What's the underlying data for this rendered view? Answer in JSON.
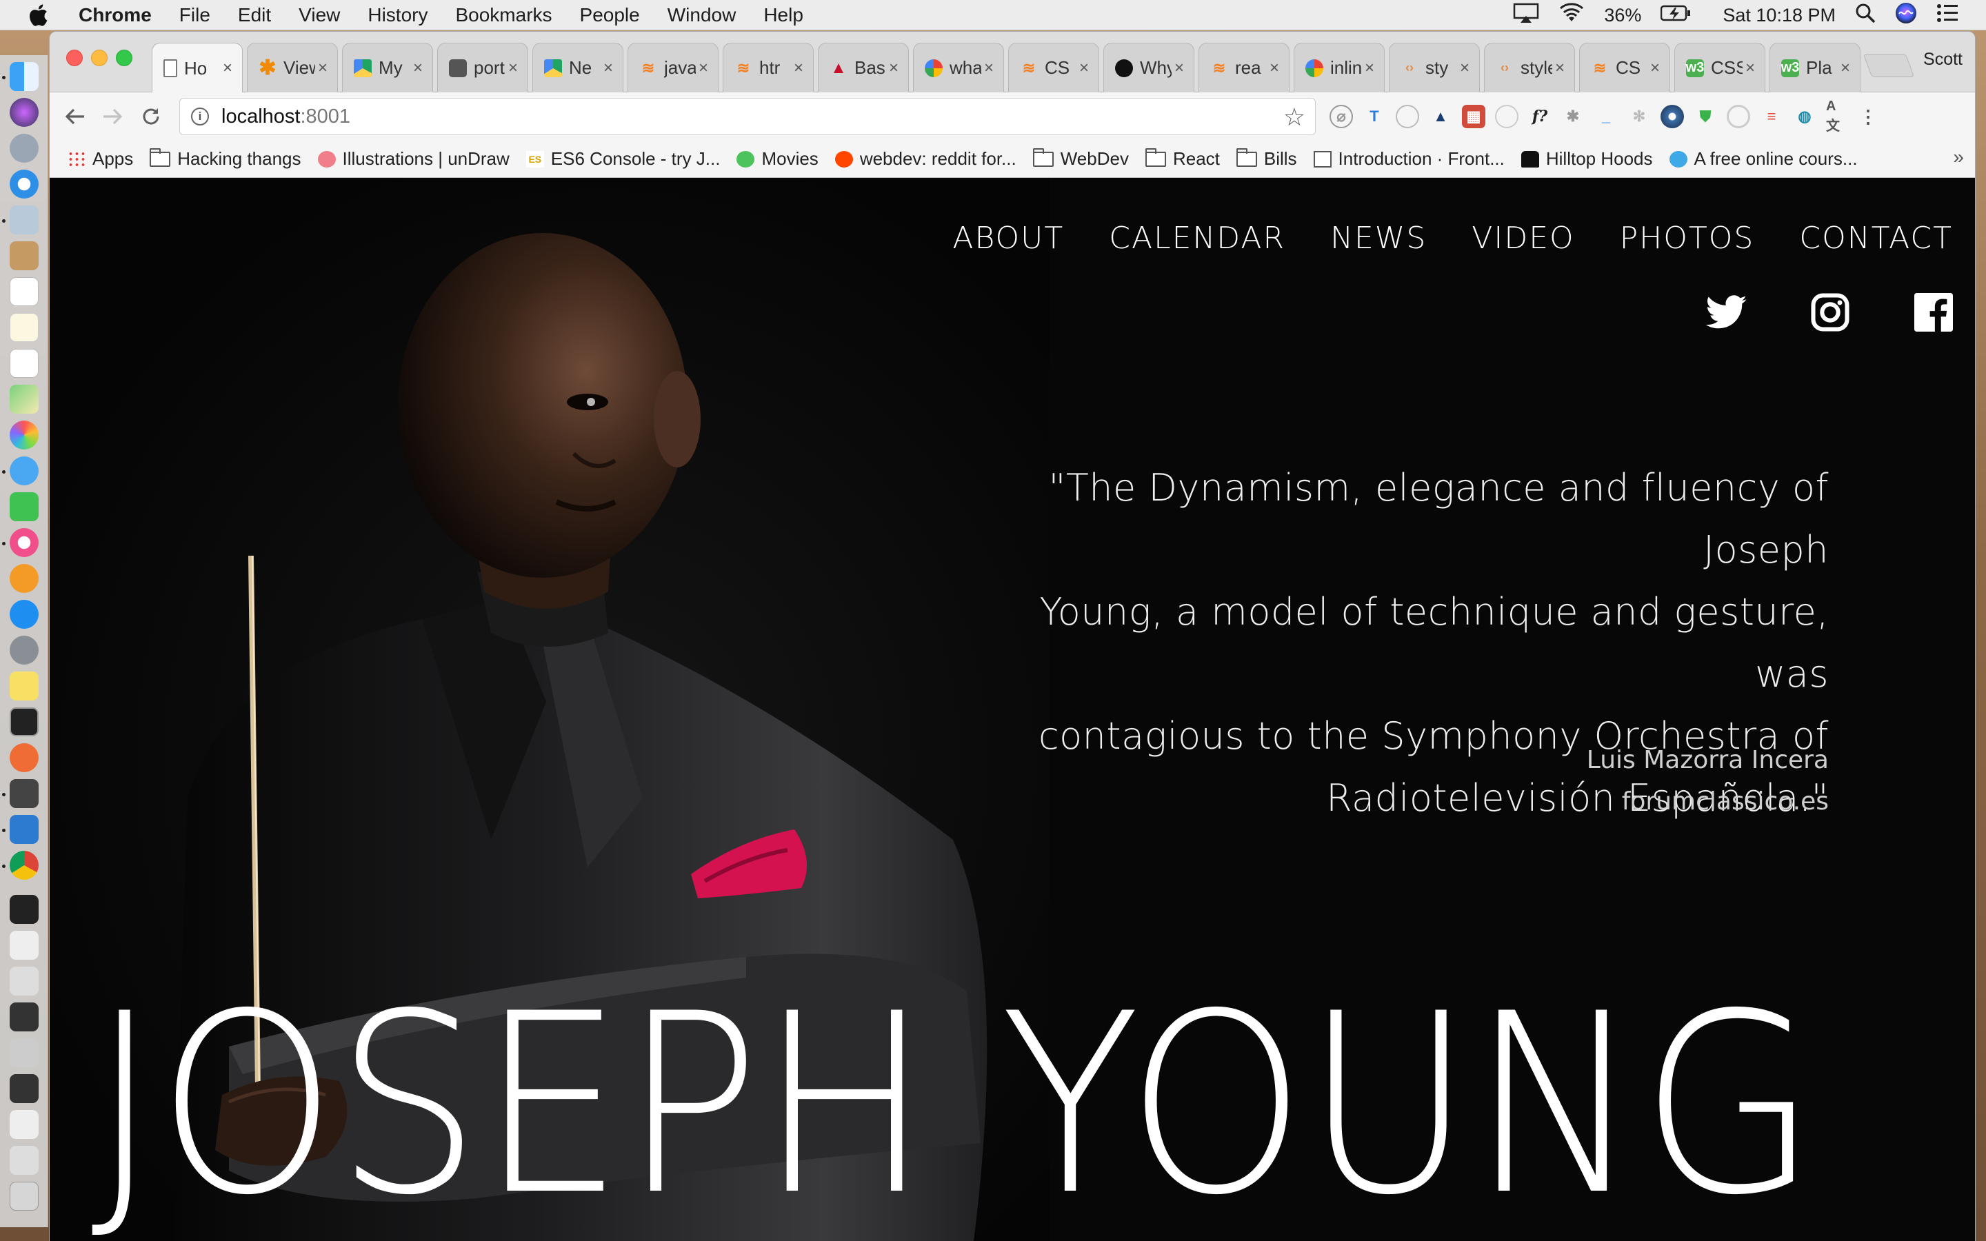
{
  "menubar": {
    "app_name": "Chrome",
    "items": [
      "File",
      "Edit",
      "View",
      "History",
      "Bookmarks",
      "People",
      "Window",
      "Help"
    ],
    "battery": "36%",
    "clock": "Sat 10:18 PM"
  },
  "browser": {
    "profile": "Scott",
    "tabs": [
      {
        "title": "Ho",
        "icon": "page-icon"
      },
      {
        "title": "View",
        "icon": "asterisk-icon"
      },
      {
        "title": "My",
        "icon": "drive-icon"
      },
      {
        "title": "portr",
        "icon": "cube-icon"
      },
      {
        "title": "Ne",
        "icon": "drive-icon"
      },
      {
        "title": "javas",
        "icon": "stackoverflow-icon"
      },
      {
        "title": "htr",
        "icon": "stackoverflow-icon"
      },
      {
        "title": "Basic",
        "icon": "triangle-icon"
      },
      {
        "title": "what",
        "icon": "google-icon"
      },
      {
        "title": "CS",
        "icon": "stackoverflow-icon"
      },
      {
        "title": "Why",
        "icon": "github-icon"
      },
      {
        "title": "rea",
        "icon": "stackoverflow-icon"
      },
      {
        "title": "inline",
        "icon": "google-icon"
      },
      {
        "title": "sty",
        "icon": "code-icon"
      },
      {
        "title": "style",
        "icon": "code-icon"
      },
      {
        "title": "CS",
        "icon": "stackoverflow-icon"
      },
      {
        "title": "CSS",
        "icon": "w3-icon"
      },
      {
        "title": "Pla",
        "icon": "w3-icon"
      }
    ],
    "address": {
      "host": "localhost",
      "port": ":8001"
    },
    "bookmarks": [
      {
        "label": "Apps",
        "icon": "apps-grid-icon"
      },
      {
        "label": "Hacking thangs",
        "icon": "folder-icon"
      },
      {
        "label": "Illustrations | unDraw",
        "icon": "undraw-icon"
      },
      {
        "label": "ES6 Console - try J...",
        "icon": "es6-icon"
      },
      {
        "label": "Movies",
        "icon": "play-icon"
      },
      {
        "label": "webdev: reddit for...",
        "icon": "reddit-icon"
      },
      {
        "label": "WebDev",
        "icon": "folder-icon"
      },
      {
        "label": "React",
        "icon": "folder-icon"
      },
      {
        "label": "Bills",
        "icon": "folder-icon"
      },
      {
        "label": "Introduction · Front...",
        "icon": "book-icon"
      },
      {
        "label": "Hilltop Hoods",
        "icon": "hat-icon"
      },
      {
        "label": "A free online cours...",
        "icon": "blue-blob-icon"
      }
    ]
  },
  "site": {
    "nav": [
      "ABOUT",
      "CALENDAR",
      "NEWS",
      "VIDEO",
      "PHOTOS",
      "CONTACT"
    ],
    "social": [
      "twitter-icon",
      "instagram-icon",
      "facebook-icon"
    ],
    "quote_lines": [
      "\"The Dynamism, elegance and fluency of Joseph",
      "Young, a model of technique and gesture, was",
      "contagious to the Symphony Orchestra of",
      "Radiotelevisión Española.\""
    ],
    "quote_author": "Luis Mazorra Incera",
    "quote_source": "forumclassico.es",
    "hero_name": "JOSEPH YOUNG"
  }
}
